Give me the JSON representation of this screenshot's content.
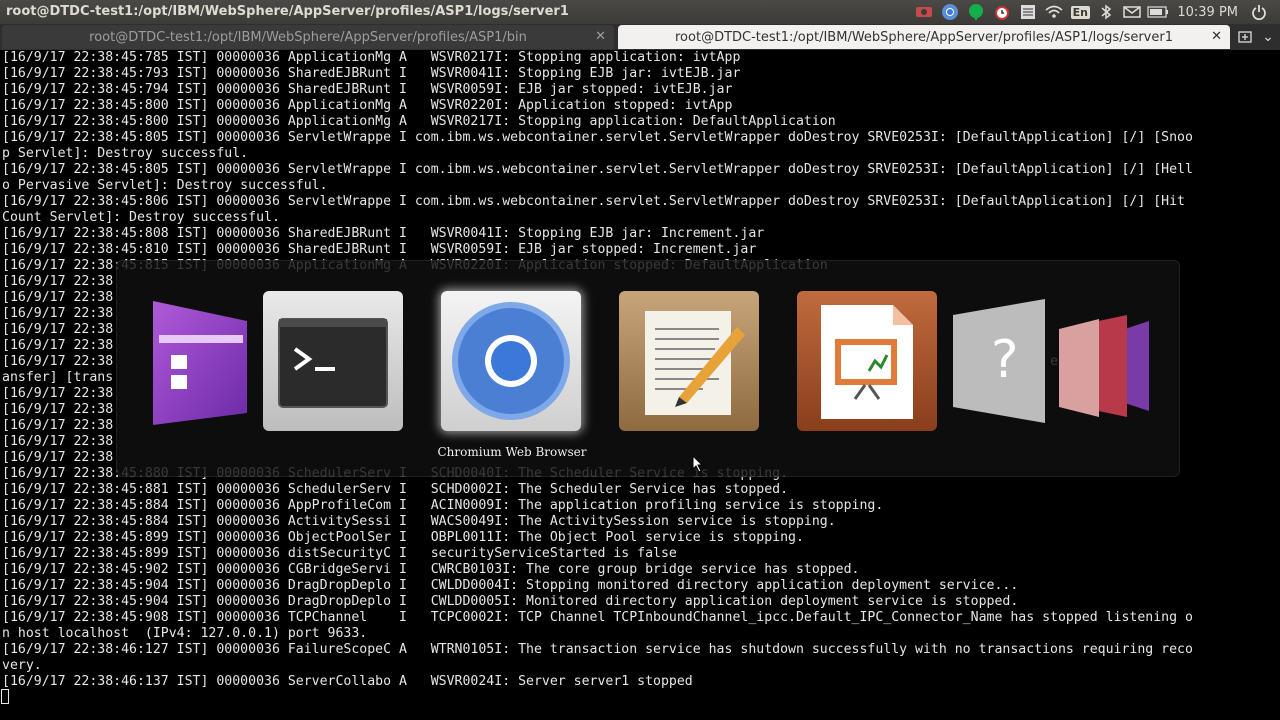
{
  "panel": {
    "window_title": "root@DTDC-test1:/opt/IBM/WebSphere/AppServer/profiles/ASP1/logs/server1",
    "tray_icons": [
      "record-icon",
      "chromium-icon",
      "hangouts-icon",
      "alarm-clock-icon",
      "notes-icon",
      "wifi-icon",
      "keyboard-layout-icon",
      "bluetooth-icon",
      "mail-icon",
      "battery-icon"
    ],
    "keyboard_layout": "En",
    "clock": "10:39 PM",
    "session_icon": "power-icon"
  },
  "tabs": [
    {
      "label": "root@DTDC-test1:/opt/IBM/WebSphere/AppServer/profiles/ASP1/bin",
      "active": false
    },
    {
      "label": "root@DTDC-test1:/opt/IBM/WebSphere/AppServer/profiles/ASP1/logs/server1",
      "active": true
    }
  ],
  "terminal": {
    "lines": [
      "[16/9/17 22:38:45:785 IST] 00000036 ApplicationMg A   WSVR0217I: Stopping application: ivtApp",
      "[16/9/17 22:38:45:793 IST] 00000036 SharedEJBRunt I   WSVR0041I: Stopping EJB jar: ivtEJB.jar",
      "[16/9/17 22:38:45:794 IST] 00000036 SharedEJBRunt I   WSVR0059I: EJB jar stopped: ivtEJB.jar",
      "[16/9/17 22:38:45:800 IST] 00000036 ApplicationMg A   WSVR0220I: Application stopped: ivtApp",
      "[16/9/17 22:38:45:800 IST] 00000036 ApplicationMg A   WSVR0217I: Stopping application: DefaultApplication",
      "[16/9/17 22:38:45:805 IST] 00000036 ServletWrappe I com.ibm.ws.webcontainer.servlet.ServletWrapper doDestroy SRVE0253I: [DefaultApplication] [/] [Snoo",
      "p Servlet]: Destroy successful.",
      "[16/9/17 22:38:45:805 IST] 00000036 ServletWrappe I com.ibm.ws.webcontainer.servlet.ServletWrapper doDestroy SRVE0253I: [DefaultApplication] [/] [Hell",
      "o Pervasive Servlet]: Destroy successful.",
      "[16/9/17 22:38:45:806 IST] 00000036 ServletWrappe I com.ibm.ws.webcontainer.servlet.ServletWrapper doDestroy SRVE0253I: [DefaultApplication] [/] [Hit",
      "Count Servlet]: Destroy successful.",
      "[16/9/17 22:38:45:808 IST] 00000036 SharedEJBRunt I   WSVR0041I: Stopping EJB jar: Increment.jar",
      "[16/9/17 22:38:45:810 IST] 00000036 SharedEJBRunt I   WSVR0059I: EJB jar stopped: Increment.jar",
      "[16/9/17 22:38:45:815 IST] 00000036 ApplicationMg A   WSVR0220I: Application stopped: DefaultApplication",
      "[16/9/17 22:38",
      "[16/9/17 22:38",
      "[16/9/17 22:38",
      "[16/9/17 22:38",
      "[16/9/17 22:38",
      "[16/9/17 22:38                                                                                                                      ed] [/FileTr",
      "ansfer] [trans",
      "[16/9/17 22:38",
      "[16/9/17 22:38",
      "[16/9/17 22:38",
      "[16/9/17 22:38",
      "[16/9/17 22:38",
      "[16/9/17 22:38:45:880 IST] 00000036 SchedulerServ I   SCHD0040I: The Scheduler Service is stopping.",
      "[16/9/17 22:38:45:881 IST] 00000036 SchedulerServ I   SCHD0002I: The Scheduler Service has stopped.",
      "[16/9/17 22:38:45:884 IST] 00000036 AppProfileCom I   ACIN0009I: The application profiling service is stopping.",
      "[16/9/17 22:38:45:884 IST] 00000036 ActivitySessi I   WACS0049I: The ActivitySession service is stopping.",
      "[16/9/17 22:38:45:899 IST] 00000036 ObjectPoolSer I   OBPL0011I: The Object Pool service is stopping.",
      "[16/9/17 22:38:45:899 IST] 00000036 distSecurityC I   securityServiceStarted is false",
      "[16/9/17 22:38:45:902 IST] 00000036 CGBridgeServi I   CWRCB0103I: The core group bridge service has stopped.",
      "[16/9/17 22:38:45:904 IST] 00000036 DragDropDeplo I   CWLDD0004I: Stopping monitored directory application deployment service...",
      "[16/9/17 22:38:45:904 IST] 00000036 DragDropDeplo I   CWLDD0005I: Monitored directory application deployment service is stopped.",
      "[16/9/17 22:38:45:908 IST] 00000036 TCPChannel    I   TCPC0002I: TCP Channel TCPInboundChannel_ipcc.Default_IPC_Connector_Name has stopped listening o",
      "n host localhost  (IPv4: 127.0.0.1) port 9633.",
      "[16/9/17 22:38:46:127 IST] 00000036 FailureScopeC A   WTRN0105I: The transaction service has shutdown successfully with no transactions requiring reco",
      "very.",
      "[16/9/17 22:38:46:137 IST] 00000036 ServerCollabo A   WSVR0024I: Server server1 stopped"
    ]
  },
  "switcher": {
    "apps": [
      {
        "name": "purple-app",
        "icon": "purple-app-icon",
        "selected": false
      },
      {
        "name": "Terminal",
        "icon": "terminal-icon",
        "selected": false
      },
      {
        "name": "Chromium Web Browser",
        "icon": "chromium-icon",
        "selected": true
      },
      {
        "name": "Text Editor",
        "icon": "text-editor-icon",
        "selected": false
      },
      {
        "name": "LibreOffice Impress",
        "icon": "libreoffice-impress-icon",
        "selected": false
      },
      {
        "name": "Help",
        "icon": "help-icon",
        "selected": false
      }
    ],
    "selected_label": "Chromium Web Browser"
  }
}
